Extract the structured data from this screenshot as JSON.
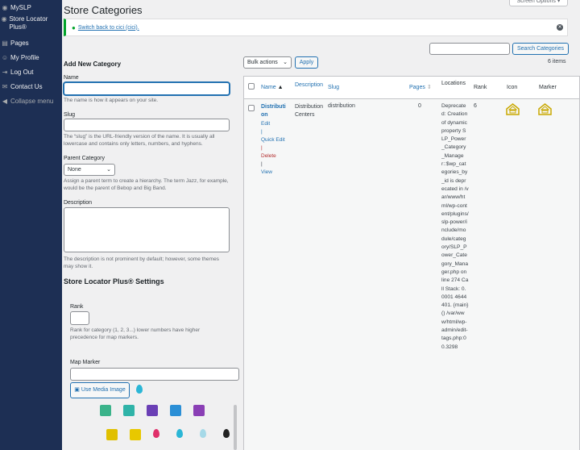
{
  "sidebar": {
    "items": [
      {
        "icon": "pin-icon",
        "label": "MySLP",
        "glyph": "◉"
      },
      {
        "icon": "store-locator-icon",
        "label": "Store Locator Plus®",
        "glyph": "◉"
      },
      {
        "icon": "pages-icon",
        "label": "Pages",
        "glyph": "▤"
      },
      {
        "icon": "profile-icon",
        "label": "My Profile",
        "glyph": "☺"
      },
      {
        "icon": "logout-icon",
        "label": "Log Out",
        "glyph": "⇥"
      },
      {
        "icon": "contact-icon",
        "label": "Contact Us",
        "glyph": "✉"
      },
      {
        "icon": "collapse-icon",
        "label": "Collapse menu",
        "glyph": "◀"
      }
    ]
  },
  "header": {
    "title": "Store Categories",
    "screen_options": "Screen Options ▾"
  },
  "notice": {
    "link": "Switch back to cici (cici)."
  },
  "form": {
    "heading": "Add New Category",
    "name_label": "Name",
    "name_help": "The name is how it appears on your site.",
    "slug_label": "Slug",
    "slug_help": "The “slug” is the URL-friendly version of the name. It is usually all lowercase and contains only letters, numbers, and hyphens.",
    "parent_label": "Parent Category",
    "parent_value": "None",
    "parent_help": "Assign a parent term to create a hierarchy. The term Jazz, for example, would be the parent of Bebop and Big Band.",
    "desc_label": "Description",
    "desc_help": "The description is not prominent by default; however, some themes may show it.",
    "slp_heading": "Store Locator Plus® Settings",
    "rank_label": "Rank",
    "rank_help": "Rank for category (1, 2, 3...) lower numbers have higher precedence for map markers.",
    "marker_label": "Map Marker",
    "media_button": "Use Media Image"
  },
  "search": {
    "button": "Search Categories"
  },
  "bulk": {
    "select": "Bulk actions",
    "apply": "Apply",
    "count": "6 items"
  },
  "table": {
    "headers": {
      "name": "Name",
      "description": "Description",
      "slug": "Slug",
      "pages": "Pages",
      "location": "Locations",
      "rank": "Rank",
      "icon": "Icon",
      "marker": "Marker"
    },
    "row": {
      "name": "Distribution",
      "edit": "Edit",
      "quick_edit": "Quick Edit",
      "delete": "Delete",
      "view": "View",
      "description": "Distribution Centers",
      "slug": "distribution",
      "pages": "0",
      "location": "Deprecated: Creation of dynamic property SLP_Power_Category_Manager::$wp_categories_by_id is deprecated in /var/www/html/wp-content/plugins/slp-power/include/module/category/SLP_Power_Category_Manager.php on line 274 Call Stack: 0.0001 4644401. {main}() /var/www/html/wp-admin/edit-tags.php:0 0.3298",
      "rank": "6"
    }
  },
  "colors": {
    "sidebar": "#1d2f54",
    "accent": "#2271b1",
    "success": "#00a32a",
    "icon_gold": "#c9a800"
  },
  "marker_grid": [
    {
      "icon": "download-marker-icon",
      "color": "#3bb38a"
    },
    {
      "icon": "cart-marker-icon",
      "color": "#2fb3a8"
    },
    {
      "icon": "tools-marker-icon",
      "color": "#6a3fb5"
    },
    {
      "icon": "info-marker-icon",
      "color": "#2b8fd6"
    },
    {
      "icon": "document-marker-icon",
      "color": "#8a3fb5"
    },
    {
      "icon": "car-marker-icon",
      "color": "#e0c000"
    },
    {
      "icon": "home-marker-icon",
      "color": "#e8c800"
    },
    {
      "icon": "pink-pin-icon",
      "color": "#e0306a"
    },
    {
      "icon": "blue-pin-icon",
      "color": "#2bb6d6"
    },
    {
      "icon": "light-pin-icon",
      "color": "#a6d9e8"
    },
    {
      "icon": "black-pin-icon",
      "color": "#222222"
    }
  ]
}
